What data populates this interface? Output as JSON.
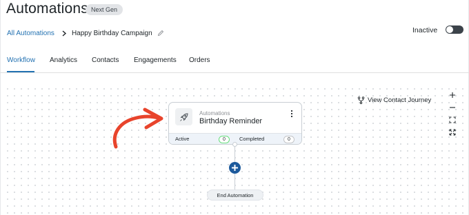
{
  "header": {
    "title": "Automations",
    "badge": "Next Gen",
    "status_label": "Inactive",
    "toggle_on": false
  },
  "breadcrumb": {
    "parent": "All Automations",
    "current": "Happy Birthday Campaign"
  },
  "tabs": [
    {
      "label": "Workflow",
      "active": true
    },
    {
      "label": "Analytics",
      "active": false
    },
    {
      "label": "Contacts",
      "active": false
    },
    {
      "label": "Engagements",
      "active": false
    },
    {
      "label": "Orders",
      "active": false
    }
  ],
  "canvas": {
    "view_journey_label": "View Contact Journey",
    "zoom_controls": [
      "zoom-in-icon",
      "zoom-out-icon",
      "fit-view-icon",
      "fullscreen-icon"
    ],
    "node": {
      "category": "Automations",
      "title": "Birthday Reminder",
      "icon": "rocket-icon",
      "active_label": "Active",
      "active_count": "0",
      "completed_label": "Completed",
      "completed_count": "0"
    },
    "end_label": "End Automation"
  },
  "colors": {
    "accent": "#2271b1",
    "add_button": "#1d5a9c",
    "annotation_arrow": "#e8442c",
    "active_count_border": "#68de7c"
  }
}
